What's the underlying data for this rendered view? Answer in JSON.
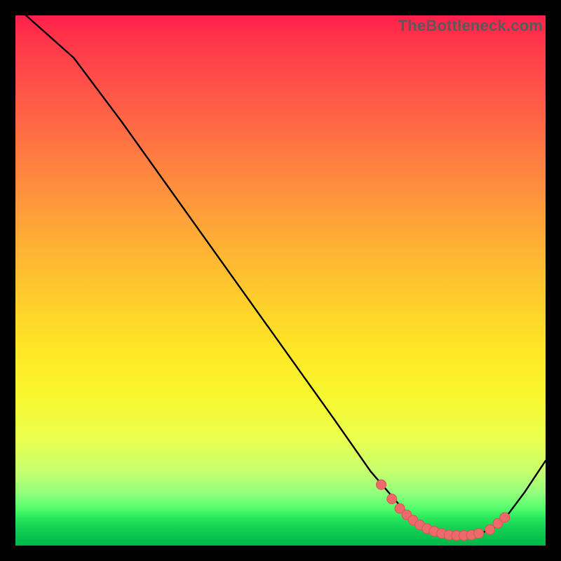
{
  "watermark": "TheBottleneck.com",
  "colors": {
    "curve_stroke": "#000000",
    "dot_fill": "#ed6a6a",
    "dot_stroke": "#d85656"
  },
  "chart_data": {
    "type": "line",
    "title": "",
    "xlabel": "",
    "ylabel": "",
    "xlim": [
      0,
      100
    ],
    "ylim": [
      0,
      100
    ],
    "grid": false,
    "legend": false,
    "curve": [
      {
        "x": 2,
        "y": 100
      },
      {
        "x": 11,
        "y": 92
      },
      {
        "x": 20,
        "y": 80
      },
      {
        "x": 30,
        "y": 66
      },
      {
        "x": 40,
        "y": 52
      },
      {
        "x": 50,
        "y": 38
      },
      {
        "x": 60,
        "y": 24
      },
      {
        "x": 67,
        "y": 14
      },
      {
        "x": 73,
        "y": 7
      },
      {
        "x": 78,
        "y": 3
      },
      {
        "x": 82,
        "y": 2
      },
      {
        "x": 86,
        "y": 2
      },
      {
        "x": 90,
        "y": 3
      },
      {
        "x": 93,
        "y": 6
      },
      {
        "x": 96,
        "y": 10
      },
      {
        "x": 100,
        "y": 16
      }
    ],
    "highlight_points": [
      {
        "x": 69,
        "y": 11.5
      },
      {
        "x": 71,
        "y": 8.8
      },
      {
        "x": 72.5,
        "y": 7.0
      },
      {
        "x": 73.8,
        "y": 5.8
      },
      {
        "x": 75,
        "y": 4.8
      },
      {
        "x": 76.3,
        "y": 3.9
      },
      {
        "x": 77.6,
        "y": 3.2
      },
      {
        "x": 79,
        "y": 2.7
      },
      {
        "x": 80.4,
        "y": 2.3
      },
      {
        "x": 81.8,
        "y": 2.0
      },
      {
        "x": 83.2,
        "y": 1.9
      },
      {
        "x": 84.6,
        "y": 1.9
      },
      {
        "x": 86,
        "y": 2.0
      },
      {
        "x": 87.4,
        "y": 2.3
      },
      {
        "x": 89.5,
        "y": 3.0
      },
      {
        "x": 91,
        "y": 4.2
      },
      {
        "x": 92.3,
        "y": 5.3
      }
    ]
  }
}
